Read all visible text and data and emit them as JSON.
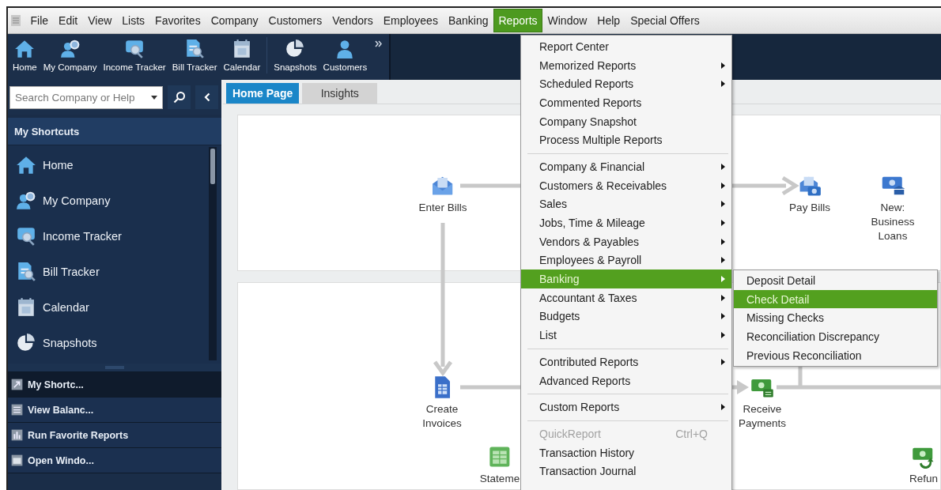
{
  "menu_bar": {
    "items": [
      {
        "label": "File",
        "selected": false
      },
      {
        "label": "Edit",
        "selected": false
      },
      {
        "label": "View",
        "selected": false
      },
      {
        "label": "Lists",
        "selected": false
      },
      {
        "label": "Favorites",
        "selected": false
      },
      {
        "label": "Company",
        "selected": false
      },
      {
        "label": "Customers",
        "selected": false
      },
      {
        "label": "Vendors",
        "selected": false
      },
      {
        "label": "Employees",
        "selected": false
      },
      {
        "label": "Banking",
        "selected": false
      },
      {
        "label": "Reports",
        "selected": true
      },
      {
        "label": "Window",
        "selected": false
      },
      {
        "label": "Help",
        "selected": false
      },
      {
        "label": "Special Offers",
        "selected": false
      }
    ]
  },
  "toolbar": {
    "groups": [
      [
        "Home",
        "My Company",
        "Income Tracker",
        "Bill Tracker",
        "Calendar"
      ],
      [
        "Snapshots",
        "Customers"
      ]
    ]
  },
  "search": {
    "placeholder": "Search Company or Help"
  },
  "sidebar": {
    "header": "My Shortcuts",
    "items": [
      "Home",
      "My Company",
      "Income Tracker",
      "Bill Tracker",
      "Calendar",
      "Snapshots"
    ],
    "panels": [
      {
        "label": "My Shortc...",
        "selected": true
      },
      {
        "label": "View Balanc...",
        "selected": false
      },
      {
        "label": "Run Favorite Reports",
        "selected": false
      },
      {
        "label": "Open Windo...",
        "selected": false
      }
    ]
  },
  "tabs": [
    {
      "label": "Home Page",
      "selected": true
    },
    {
      "label": "Insights",
      "selected": false
    }
  ],
  "home_page": {
    "nodes": [
      {
        "label": "Enter Bills"
      },
      {
        "label": "Pay Bills"
      },
      {
        "label": "New: Business Loans"
      },
      {
        "label": "Create Invoices"
      },
      {
        "label": "Receive Payments"
      },
      {
        "label": "Stateme"
      },
      {
        "label": "Refun"
      }
    ]
  },
  "reports_menu": {
    "sections": [
      [
        {
          "label": "Report Center",
          "submenu": false,
          "selected": false,
          "disabled": false
        },
        {
          "label": "Memorized Reports",
          "submenu": true,
          "selected": false,
          "disabled": false
        },
        {
          "label": "Scheduled Reports",
          "submenu": true,
          "selected": false,
          "disabled": false
        },
        {
          "label": "Commented Reports",
          "submenu": false,
          "selected": false,
          "disabled": false
        },
        {
          "label": "Company Snapshot",
          "submenu": false,
          "selected": false,
          "disabled": false
        },
        {
          "label": "Process Multiple Reports",
          "submenu": false,
          "selected": false,
          "disabled": false
        }
      ],
      [
        {
          "label": "Company & Financial",
          "submenu": true,
          "selected": false,
          "disabled": false
        },
        {
          "label": "Customers & Receivables",
          "submenu": true,
          "selected": false,
          "disabled": false
        },
        {
          "label": "Sales",
          "submenu": true,
          "selected": false,
          "disabled": false
        },
        {
          "label": "Jobs, Time & Mileage",
          "submenu": true,
          "selected": false,
          "disabled": false
        },
        {
          "label": "Vendors & Payables",
          "submenu": true,
          "selected": false,
          "disabled": false
        },
        {
          "label": "Employees & Payroll",
          "submenu": true,
          "selected": false,
          "disabled": false
        },
        {
          "label": "Banking",
          "submenu": true,
          "selected": true,
          "disabled": false
        },
        {
          "label": "Accountant & Taxes",
          "submenu": true,
          "selected": false,
          "disabled": false
        },
        {
          "label": "Budgets",
          "submenu": true,
          "selected": false,
          "disabled": false
        },
        {
          "label": "List",
          "submenu": true,
          "selected": false,
          "disabled": false
        }
      ],
      [
        {
          "label": "Contributed Reports",
          "submenu": true,
          "selected": false,
          "disabled": false
        },
        {
          "label": "Advanced Reports",
          "submenu": false,
          "selected": false,
          "disabled": false
        }
      ],
      [
        {
          "label": "Custom Reports",
          "submenu": true,
          "selected": false,
          "disabled": false
        }
      ],
      [
        {
          "label": "QuickReport",
          "shortcut": "Ctrl+Q",
          "submenu": false,
          "selected": false,
          "disabled": true
        },
        {
          "label": "Transaction History",
          "submenu": false,
          "selected": false,
          "disabled": false
        },
        {
          "label": "Transaction Journal",
          "submenu": false,
          "selected": false,
          "disabled": false
        }
      ]
    ]
  },
  "banking_submenu": {
    "items": [
      {
        "label": "Deposit Detail",
        "selected": false
      },
      {
        "label": "Check Detail",
        "selected": true
      },
      {
        "label": "Missing Checks",
        "selected": false
      },
      {
        "label": "Reconciliation Discrepancy",
        "selected": false
      },
      {
        "label": "Previous Reconciliation",
        "selected": false
      }
    ]
  }
}
